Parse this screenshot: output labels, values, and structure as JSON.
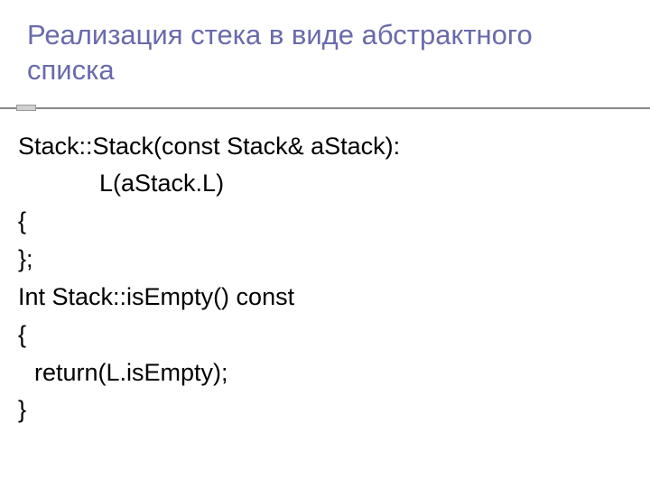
{
  "title": "Реализация стека в виде абстрактного списка",
  "code": {
    "line1": "Stack::Stack(const Stack& aStack):",
    "line2": "L(aStack.L)",
    "line3": "{",
    "line4": "};",
    "line5": "",
    "line6": "Int Stack::isEmpty() const",
    "line7": "{",
    "line8": "return(L.isEmpty);",
    "line9": "}"
  }
}
